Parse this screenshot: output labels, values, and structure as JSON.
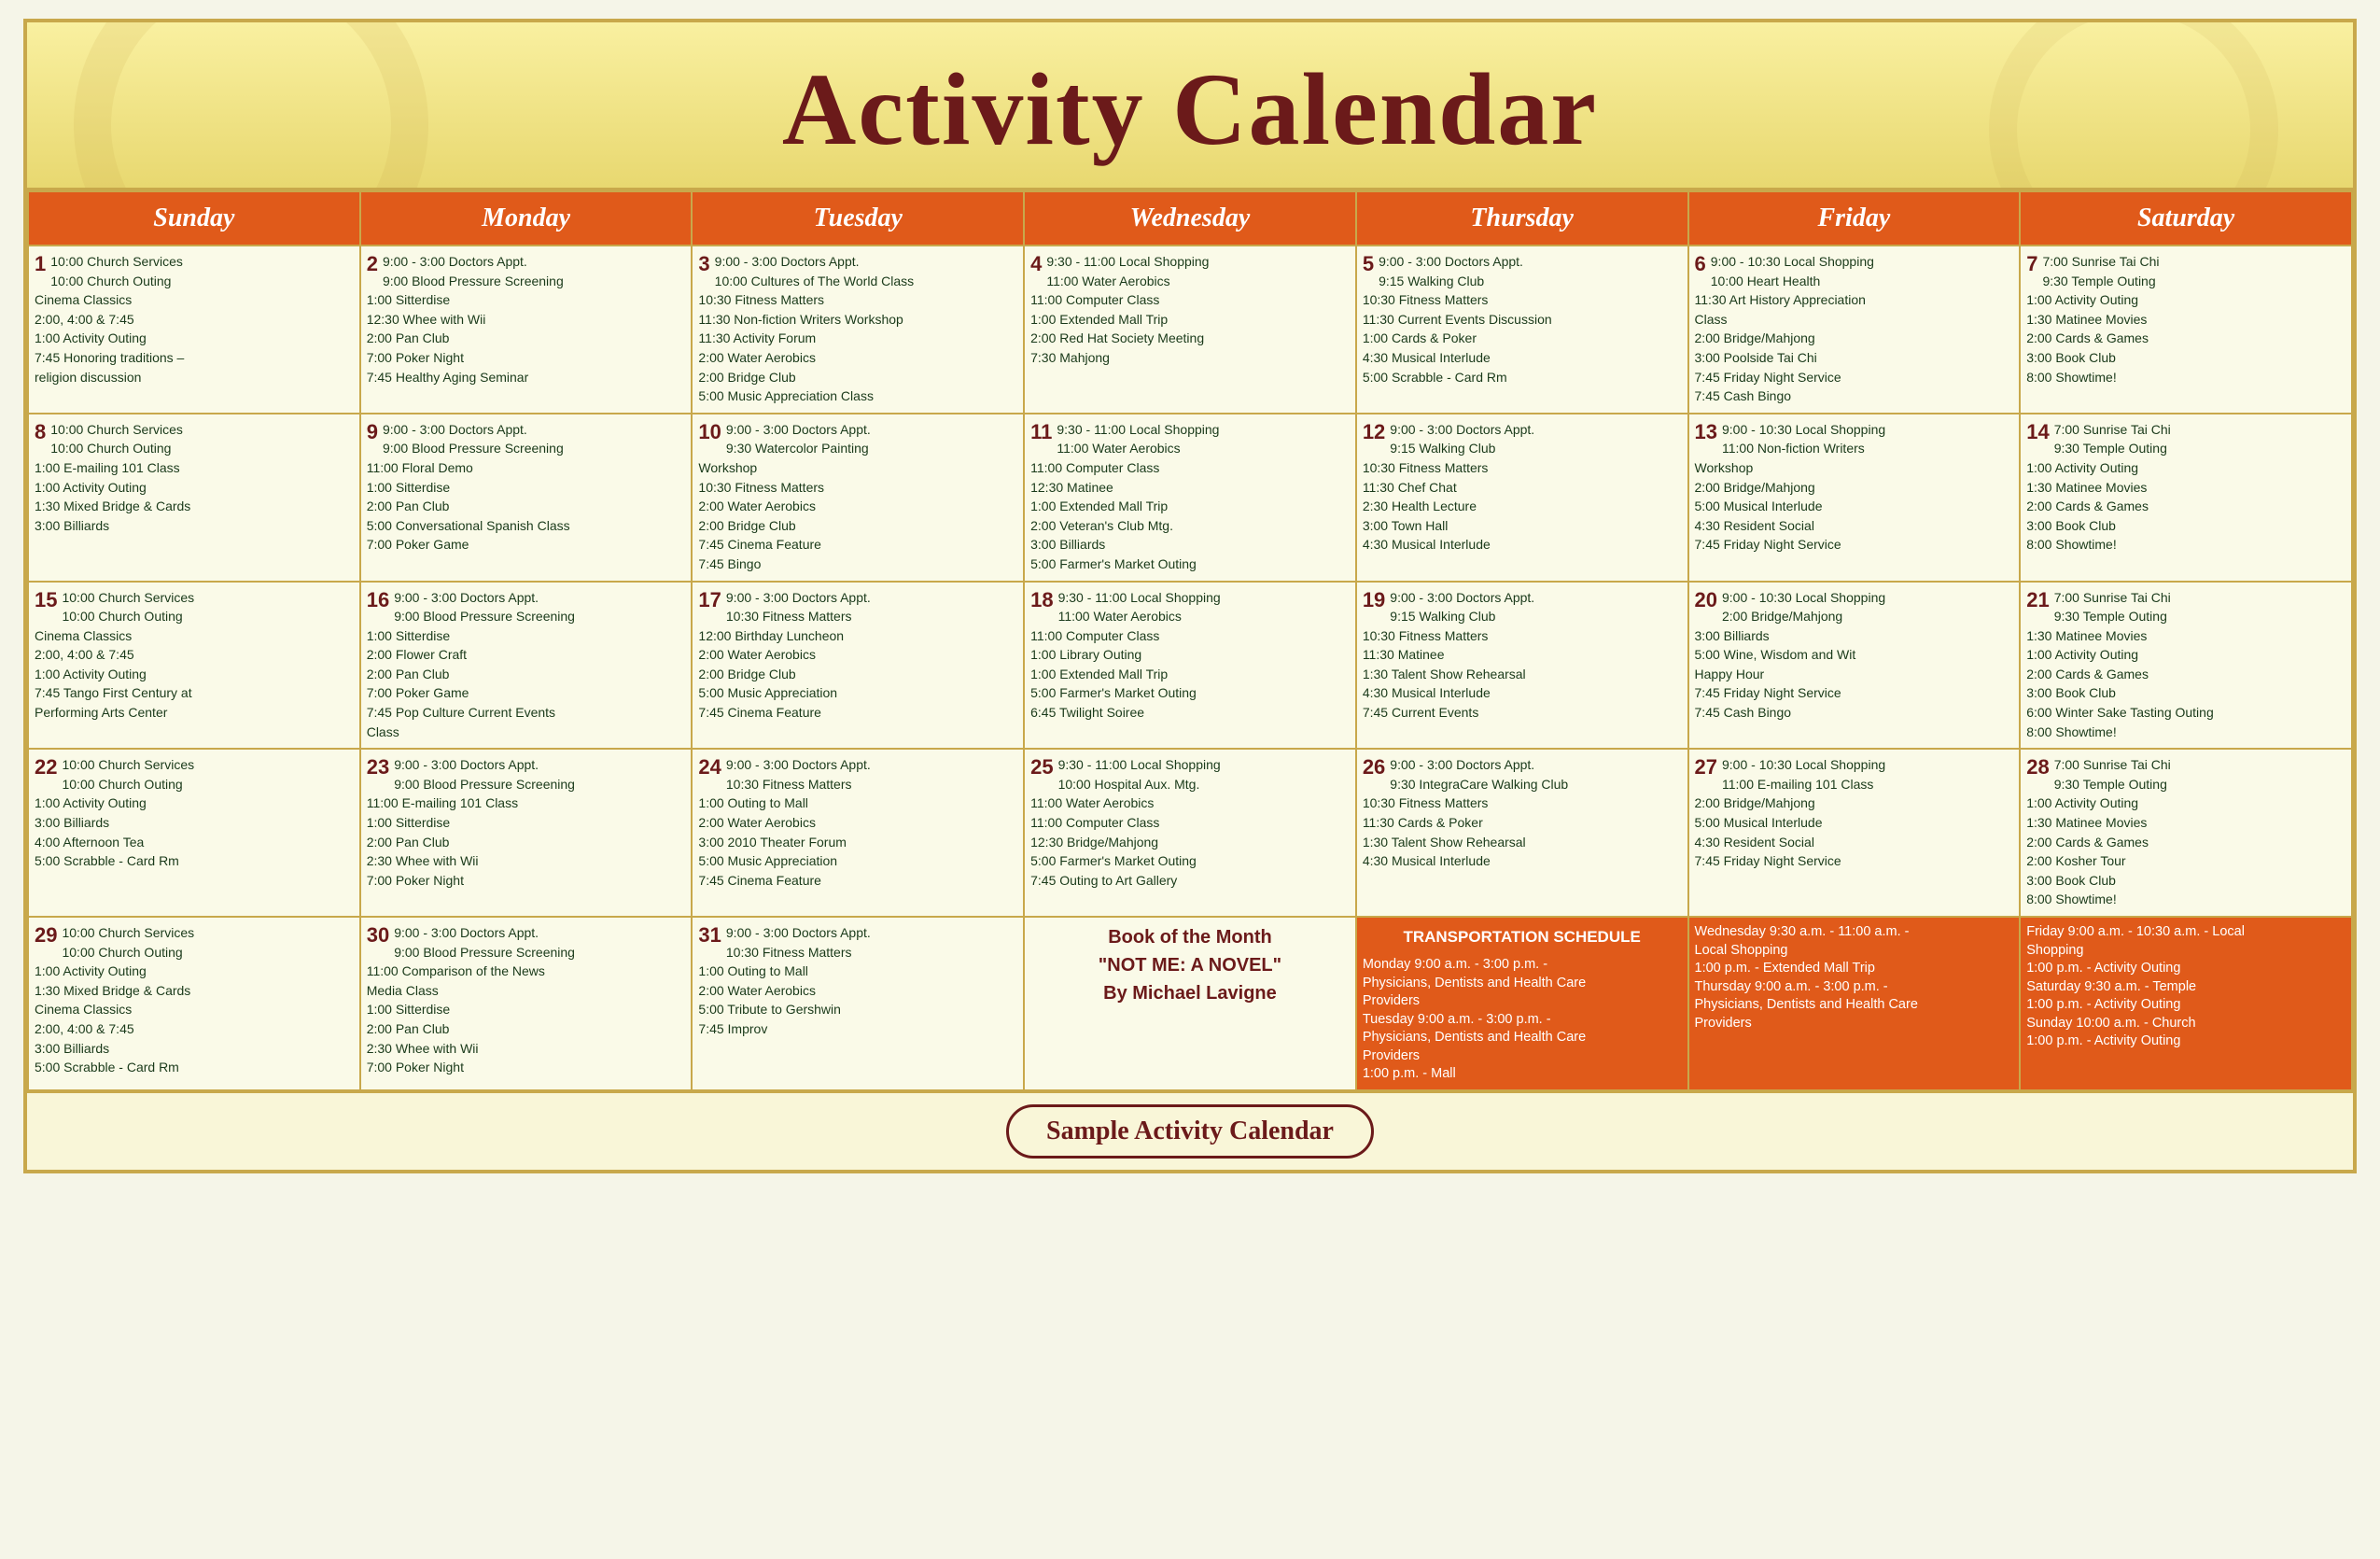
{
  "header": {
    "title": "Activity Calendar"
  },
  "days": [
    "Sunday",
    "Monday",
    "Tuesday",
    "Wednesday",
    "Thursday",
    "Friday",
    "Saturday"
  ],
  "footer": "Sample Activity Calendar",
  "weeks": [
    {
      "sun": {
        "num": "1",
        "events": [
          "10:00 Church Services",
          "10:00 Church Outing",
          "Cinema Classics",
          "2:00, 4:00 & 7:45",
          "1:00  Activity Outing",
          "7:45 Honoring traditions –",
          "religion discussion"
        ]
      },
      "mon": {
        "num": "2",
        "events": [
          "9:00  -  3:00 Doctors Appt.",
          "9:00 Blood Pressure Screening",
          "1:00 Sitterdise",
          "12:30 Whee with Wii",
          "2:00 Pan Club",
          "7:00 Poker Night",
          "7:45 Healthy Aging Seminar"
        ]
      },
      "tue": {
        "num": "3",
        "events": [
          "9:00  -  3:00 Doctors Appt.",
          "10:00 Cultures of The World Class",
          "10:30 Fitness Matters",
          "11:30 Non-fiction Writers Workshop",
          "11:30 Activity Forum",
          "2:00 Water Aerobics",
          "2:00 Bridge Club",
          "5:00 Music Appreciation Class"
        ]
      },
      "wed": {
        "num": "4",
        "events": [
          "9:30  -  11:00 Local Shopping",
          "11:00 Water Aerobics",
          "11:00 Computer Class",
          "1:00 Extended Mall Trip",
          "2:00 Red Hat Society Meeting",
          "7:30 Mahjong"
        ]
      },
      "thu": {
        "num": "5",
        "events": [
          "9:00  -  3:00 Doctors Appt.",
          "9:15 Walking Club",
          "10:30 Fitness Matters",
          "11:30 Current Events Discussion",
          "1:00 Cards & Poker",
          "4:30 Musical Interlude",
          "5:00 Scrabble - Card Rm"
        ]
      },
      "fri": {
        "num": "6",
        "events": [
          "9:00  -  10:30 Local Shopping",
          "10:00 Heart Health",
          "11:30 Art History Appreciation",
          "Class",
          "2:00 Bridge/Mahjong",
          "3:00 Poolside Tai Chi",
          "7:45 Friday Night Service",
          "7:45 Cash Bingo"
        ]
      },
      "sat": {
        "num": "7",
        "events": [
          "7:00 Sunrise Tai Chi",
          "9:30 Temple Outing",
          "1:00  Activity Outing",
          "1:30 Matinee Movies",
          "2:00 Cards & Games",
          "3:00 Book Club",
          "8:00 Showtime!"
        ]
      }
    },
    {
      "sun": {
        "num": "8",
        "events": [
          "10:00 Church Services",
          "10:00 Church Outing",
          "1:00 E-mailing 101 Class",
          "1:00  Activity Outing",
          "1:30 Mixed Bridge & Cards",
          "3:00 Billiards"
        ]
      },
      "mon": {
        "num": "9",
        "events": [
          "9:00  -  3:00 Doctors Appt.",
          "9:00 Blood Pressure Screening",
          "11:00 Floral Demo",
          "1:00 Sitterdise",
          "2:00 Pan Club",
          "5:00 Conversational Spanish Class",
          "7:00 Poker Game"
        ]
      },
      "tue": {
        "num": "10",
        "events": [
          "9:00  -  3:00 Doctors Appt.",
          "9:30 Watercolor Painting",
          "Workshop",
          "10:30 Fitness Matters",
          "2:00 Water Aerobics",
          "2:00 Bridge Club",
          "7:45 Cinema Feature",
          "7:45 Bingo"
        ]
      },
      "wed": {
        "num": "11",
        "events": [
          "9:30  -  11:00 Local Shopping",
          "11:00 Water Aerobics",
          "11:00 Computer Class",
          "12:30 Matinee",
          "1:00 Extended Mall Trip",
          "2:00 Veteran's Club Mtg.",
          "3:00 Billiards",
          "5:00 Farmer's Market Outing"
        ]
      },
      "thu": {
        "num": "12",
        "events": [
          "9:00  -  3:00 Doctors Appt.",
          "9:15 Walking Club",
          "10:30 Fitness Matters",
          "11:30 Chef Chat",
          "2:30 Health Lecture",
          "3:00 Town Hall",
          "4:30 Musical Interlude"
        ]
      },
      "fri": {
        "num": "13",
        "events": [
          "9:00  -  10:30 Local Shopping",
          "11:00 Non-fiction Writers",
          "Workshop",
          "2:00 Bridge/Mahjong",
          "5:00 Musical Interlude",
          "4:30 Resident Social",
          "7:45 Friday Night Service"
        ]
      },
      "sat": {
        "num": "14",
        "events": [
          "7:00 Sunrise Tai Chi",
          "9:30 Temple Outing",
          "1:00  Activity Outing",
          "1:30 Matinee Movies",
          "2:00 Cards & Games",
          "3:00 Book Club",
          "8:00 Showtime!"
        ]
      }
    },
    {
      "sun": {
        "num": "15",
        "events": [
          "10:00 Church Services",
          "10:00 Church Outing",
          "Cinema Classics",
          "2:00, 4:00 & 7:45",
          "1:00  Activity Outing",
          "7:45 Tango First Century at",
          "Performing Arts Center"
        ]
      },
      "mon": {
        "num": "16",
        "events": [
          "9:00  -  3:00 Doctors Appt.",
          "9:00 Blood Pressure Screening",
          "1:00 Sitterdise",
          "2:00 Flower Craft",
          "2:00 Pan Club",
          "7:00 Poker Game",
          "7:45 Pop Culture Current Events",
          "Class"
        ]
      },
      "tue": {
        "num": "17",
        "events": [
          "9:00  -  3:00 Doctors Appt.",
          "10:30 Fitness Matters",
          "12:00 Birthday Luncheon",
          "2:00 Water Aerobics",
          "2:00 Bridge Club",
          "5:00 Music Appreciation",
          "7:45 Cinema Feature"
        ]
      },
      "wed": {
        "num": "18",
        "events": [
          "9:30  -  11:00 Local Shopping",
          "11:00 Water Aerobics",
          "11:00 Computer Class",
          "1:00 Library Outing",
          "1:00 Extended Mall Trip",
          "5:00 Farmer's Market Outing",
          "6:45 Twilight Soiree"
        ]
      },
      "thu": {
        "num": "19",
        "events": [
          "9:00  -  3:00 Doctors Appt.",
          "9:15 Walking Club",
          "10:30 Fitness Matters",
          "11:30 Matinee",
          "1:30 Talent Show Rehearsal",
          "4:30 Musical Interlude",
          "7:45 Current Events"
        ]
      },
      "fri": {
        "num": "20",
        "events": [
          "9:00  -  10:30 Local Shopping",
          "2:00 Bridge/Mahjong",
          "3:00 Billiards",
          "5:00 Wine, Wisdom and Wit",
          "Happy Hour",
          "7:45 Friday Night Service",
          "7:45 Cash Bingo"
        ]
      },
      "sat": {
        "num": "21",
        "events": [
          "7:00 Sunrise Tai Chi",
          "9:30 Temple Outing",
          "1:30 Matinee Movies",
          "1:00  Activity Outing",
          "2:00 Cards & Games",
          "3:00 Book Club",
          "6:00 Winter Sake Tasting Outing",
          "8:00 Showtime!"
        ]
      }
    },
    {
      "sun": {
        "num": "22",
        "events": [
          "10:00 Church Services",
          "10:00 Church Outing",
          "1:00  Activity Outing",
          "3:00 Billiards",
          "4:00 Afternoon Tea",
          "5:00 Scrabble - Card Rm"
        ]
      },
      "mon": {
        "num": "23",
        "events": [
          "9:00  -  3:00 Doctors Appt.",
          "9:00 Blood Pressure Screening",
          "11:00 E-mailing 101 Class",
          "1:00 Sitterdise",
          "2:00 Pan Club",
          "2:30 Whee with Wii",
          "7:00 Poker Night"
        ]
      },
      "tue": {
        "num": "24",
        "events": [
          "9:00  -  3:00 Doctors Appt.",
          "10:30 Fitness Matters",
          "1:00 Outing to Mall",
          "2:00 Water Aerobics",
          "3:00 2010 Theater Forum",
          "5:00 Music Appreciation",
          "7:45 Cinema Feature"
        ]
      },
      "wed": {
        "num": "25",
        "events": [
          "9:30  -  11:00 Local Shopping",
          "10:00 Hospital Aux. Mtg.",
          "11:00 Water Aerobics",
          "11:00 Computer Class",
          "12:30 Bridge/Mahjong",
          "5:00 Farmer's Market Outing",
          "7:45 Outing to Art Gallery"
        ]
      },
      "thu": {
        "num": "26",
        "events": [
          "9:00  -  3:00 Doctors Appt.",
          "9:30 IntegraCare Walking Club",
          "10:30 Fitness Matters",
          "11:30 Cards & Poker",
          "1:30 Talent Show Rehearsal",
          "4:30 Musical Interlude"
        ]
      },
      "fri": {
        "num": "27",
        "events": [
          "9:00  -  10:30 Local Shopping",
          "11:00 E-mailing 101 Class",
          "2:00 Bridge/Mahjong",
          "5:00 Musical Interlude",
          "4:30 Resident Social",
          "7:45 Friday Night Service"
        ]
      },
      "sat": {
        "num": "28",
        "events": [
          "7:00 Sunrise Tai Chi",
          "9:30 Temple Outing",
          "1:00  Activity Outing",
          "1:30 Matinee Movies",
          "2:00 Cards & Games",
          "2:00 Kosher Tour",
          "3:00 Book Club",
          "8:00 Showtime!"
        ]
      }
    },
    {
      "sun": {
        "num": "29",
        "events": [
          "10:00 Church Services",
          "10:00 Church Outing",
          "1:00  Activity Outing",
          "1:30 Mixed Bridge & Cards",
          "Cinema Classics",
          "2:00, 4:00 & 7:45",
          "3:00 Billiards",
          "5:00 Scrabble - Card Rm"
        ]
      },
      "mon": {
        "num": "30",
        "events": [
          "9:00  -  3:00 Doctors Appt.",
          "9:00 Blood Pressure Screening",
          "11:00 Comparison of the News",
          "Media Class",
          "1:00 Sitterdise",
          "2:00 Pan Club",
          "2:30 Whee with Wii",
          "7:00 Poker Night"
        ]
      },
      "tue": {
        "num": "31",
        "events": [
          "9:00  -  3:00 Doctors Appt.",
          "10:30 Fitness Matters",
          "1:00 Outing to Mall",
          "2:00 Water Aerobics",
          "5:00 Tribute to Gershwin",
          "7:45 Improv"
        ]
      },
      "book": {
        "line1": "Book of the Month",
        "line2": "\"NOT ME: A NOVEL\"",
        "line3": "By Michael Lavigne"
      },
      "transport_thu": {
        "header": "TRANSPORTATION SCHEDULE",
        "lines": [
          "Monday 9:00 a.m. - 3:00 p.m. -",
          "Physicians, Dentists and Health Care",
          "Providers",
          "Tuesday 9:00 a.m. - 3:00 p.m. -",
          "Physicians, Dentists and Health Care",
          "Providers",
          "1:00 p.m. - Mall"
        ]
      },
      "transport_fri": {
        "lines": [
          "Wednesday 9:30 a.m. - 11:00 a.m. -",
          "Local Shopping",
          "1:00 p.m. - Extended Mall Trip",
          "Thursday 9:00 a.m. - 3:00 p.m. -",
          "Physicians, Dentists and Health Care",
          "Providers"
        ]
      },
      "transport_sat": {
        "lines": [
          "Friday 9:00 a.m. - 10:30 a.m. - Local",
          "Shopping",
          "1:00 p.m. - Activity Outing",
          "Saturday 9:30 a.m. - Temple",
          "1:00 p.m. - Activity Outing",
          "Sunday 10:00 a.m. - Church",
          "1:00 p.m. - Activity Outing"
        ]
      }
    }
  ]
}
